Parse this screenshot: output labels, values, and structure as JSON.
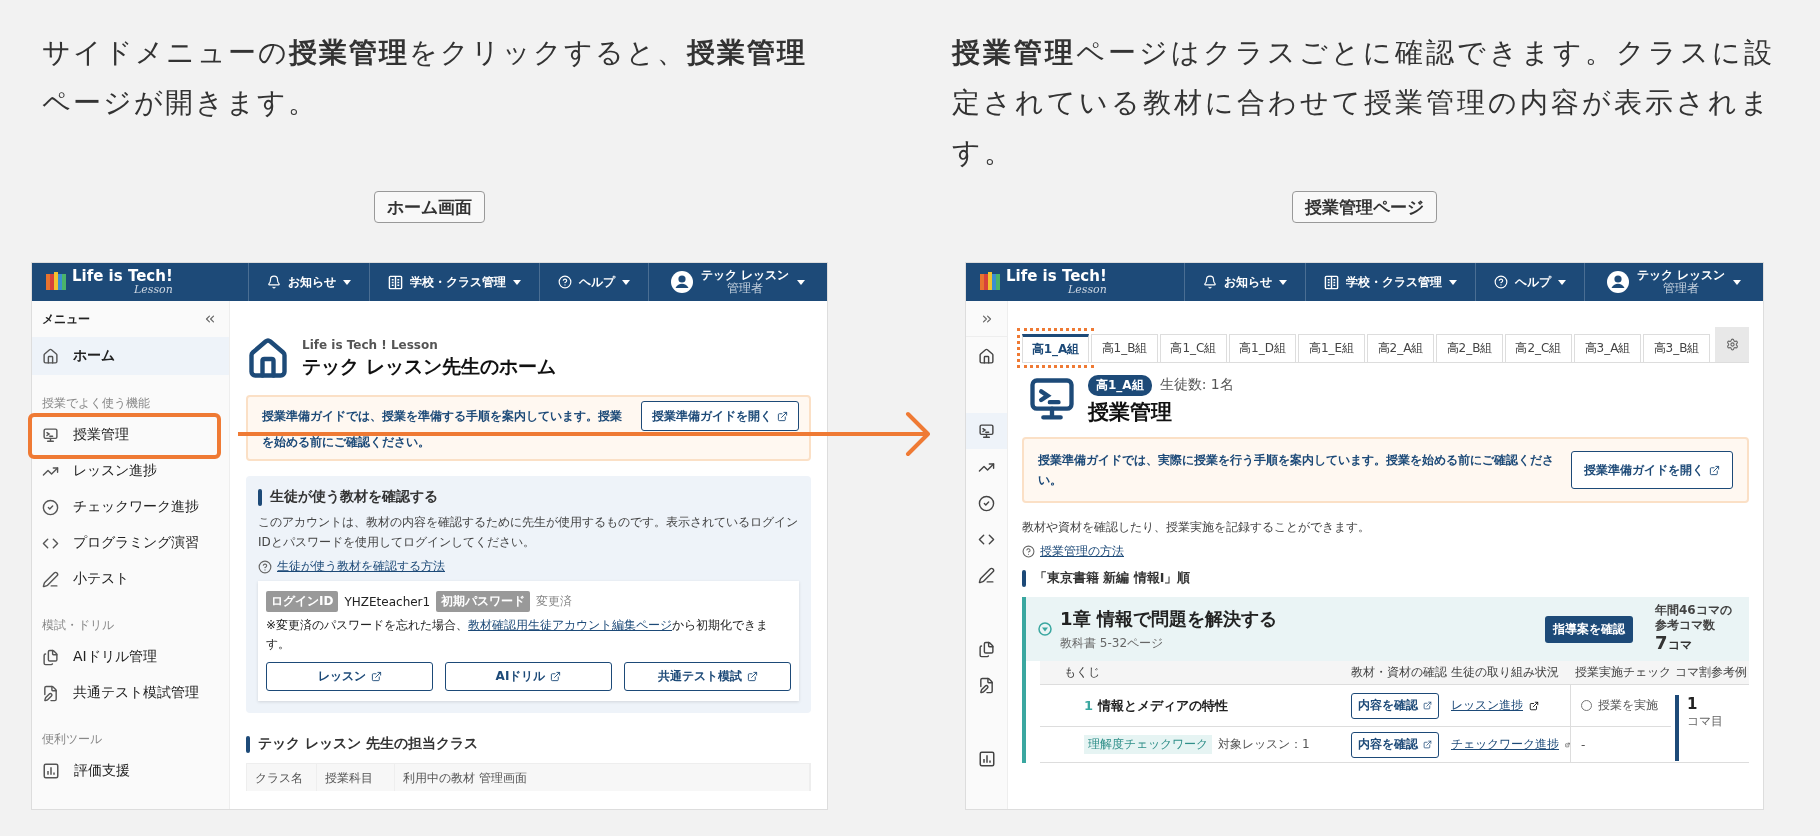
{
  "left": {
    "intro": "サイドメニューの**授業管理**をクリックすると、**授業管理**ページが開きます。",
    "caption": "ホーム画面",
    "screen": {
      "header": {
        "logo": "Life is Tech!",
        "logo_sub": "Lesson",
        "nav": [
          {
            "label": "お知らせ",
            "kind": "bell"
          },
          {
            "label": "学校・クラス管理",
            "kind": "building"
          },
          {
            "label": "ヘルプ",
            "kind": "help"
          }
        ],
        "user": {
          "name": "テック レッスン",
          "role": "管理者"
        }
      },
      "sidebar": {
        "title": "メニュー",
        "sections": [
          {
            "items": [
              {
                "label": "ホーム",
                "kind": "home",
                "selected": true,
                "highlighted": false
              }
            ]
          },
          {
            "heading": "授業でよく使う機能",
            "items": [
              {
                "label": "授業管理",
                "kind": "monitor",
                "selected": false,
                "highlighted": true
              },
              {
                "label": "レッスン進捗",
                "kind": "trend",
                "selected": false,
                "highlighted": false
              },
              {
                "label": "チェックワーク進捗",
                "kind": "check",
                "selected": false,
                "highlighted": false
              },
              {
                "label": "プログラミング演習",
                "kind": "code",
                "selected": false,
                "highlighted": false
              },
              {
                "label": "小テスト",
                "kind": "pen",
                "selected": false,
                "highlighted": false
              }
            ]
          },
          {
            "heading": "模試・ドリル",
            "items": [
              {
                "label": "AIドリル管理",
                "kind": "docs",
                "selected": false,
                "highlighted": false
              },
              {
                "label": "共通テスト模試管理",
                "kind": "docedit",
                "selected": false,
                "highlighted": false
              }
            ]
          },
          {
            "heading": "便利ツール",
            "items": [
              {
                "label": "評価支援",
                "kind": "chart",
                "selected": false,
                "highlighted": false
              }
            ]
          }
        ]
      },
      "brand": "Life is Tech ! Lesson",
      "title": "テック レッスン先生のホーム",
      "notice": {
        "text": "授業準備ガイドでは、授業を準備する手順を案内しています。授業を始める前にご確認ください。",
        "button": "授業準備ガイドを開く"
      },
      "student_panel": {
        "heading": "生徒が使う教材を確認する",
        "body": "このアカウントは、教材の内容を確認するために先生が使用するものです。表示されているログインIDとパスワードを使用してログインしてください。",
        "help_link": "生徒が使う教材を確認する方法",
        "login": {
          "id_label": "ログインID",
          "id": "YHZEteacher1",
          "pw_label": "初期パスワード",
          "pw": "変更済"
        },
        "note_mark": "※",
        "note_before": "変更済のパスワードを忘れた場合、",
        "note_link": "教材確認用生徒アカウント編集ページ",
        "note_after": "から初期化できます。",
        "buttons": [
          "レッスン",
          "AIドリル",
          "共通テスト模試"
        ]
      },
      "classes": {
        "heading": "テック レッスン 先生の担当クラス",
        "columns": [
          "クラス名",
          "授業科目",
          "利用中の教材 管理画面"
        ]
      }
    }
  },
  "right": {
    "intro": "**授業管理**ページはクラスごとに確認できます。クラスに設定されている教材に合わせて授業管理の内容が表示されます。",
    "caption": "授業管理ページ",
    "screen": {
      "header": {
        "logo": "Life is Tech!",
        "logo_sub": "Lesson",
        "nav": [
          {
            "label": "お知らせ",
            "kind": "bell"
          },
          {
            "label": "学校・クラス管理",
            "kind": "building"
          },
          {
            "label": "ヘルプ",
            "kind": "help"
          }
        ],
        "user": {
          "name": "テック レッスン",
          "role": "管理者"
        }
      },
      "rail": {
        "groups": [
          {
            "items": [
              {
                "kind": "home",
                "selected": false
              }
            ]
          },
          {
            "items": [
              {
                "kind": "monitor",
                "selected": true
              },
              {
                "kind": "trend",
                "selected": false
              },
              {
                "kind": "check",
                "selected": false
              },
              {
                "kind": "code",
                "selected": false
              },
              {
                "kind": "pen",
                "selected": false
              }
            ]
          },
          {
            "items": [
              {
                "kind": "docs",
                "selected": false
              },
              {
                "kind": "docedit",
                "selected": false
              }
            ]
          },
          {
            "items": [
              {
                "kind": "chart",
                "selected": false
              }
            ]
          }
        ]
      },
      "tabs": [
        {
          "label": "高1_A組",
          "selected": true,
          "highlighted": true
        },
        {
          "label": "高1_B組",
          "selected": false,
          "highlighted": false
        },
        {
          "label": "高1_C組",
          "selected": false,
          "highlighted": false
        },
        {
          "label": "高1_D組",
          "selected": false,
          "highlighted": false
        },
        {
          "label": "高1_E組",
          "selected": false,
          "highlighted": false
        },
        {
          "label": "高2_A組",
          "selected": false,
          "highlighted": false
        },
        {
          "label": "高2_B組",
          "selected": false,
          "highlighted": false
        },
        {
          "label": "高2_C組",
          "selected": false,
          "highlighted": false
        },
        {
          "label": "高3_A組",
          "selected": false,
          "highlighted": false
        },
        {
          "label": "高3_B組",
          "selected": false,
          "highlighted": false
        }
      ],
      "class_badge": "高1_A組",
      "student_count": "生徒数: 1名",
      "title": "授業管理",
      "notice": {
        "text": "授業準備ガイドでは、実際に授業を行う手順を案内しています。授業を始める前にご確認ください。",
        "button": "授業準備ガイドを開く"
      },
      "description": "教材や資材を確認したり、授業実施を記録することができます。",
      "help_link": "授業管理の方法",
      "order_heading": "「東京書籍 新編 情報I」順",
      "chapter": {
        "title": "1章 情報で問題を解決する",
        "pages": "教科書 5-32ページ",
        "expanded": true,
        "guide_button": "指導案を確認",
        "annual": "年間46コマの参考コマ数",
        "count": "7",
        "unit": "コマ",
        "columns": [
          "もくじ",
          "教材・資材の確認",
          "生徒の取り組み状況",
          "授業実施チェック",
          "コマ割参考例"
        ],
        "lessons": [
          {
            "number": "1",
            "title": "情報とメディアの特性",
            "button": "内容を確認",
            "link": "レッスン進捗",
            "check": {
              "label": "授業を実施",
              "checked": false
            },
            "koma": "1",
            "koma_unit": "コマ目",
            "checkworks": [
              {
                "tag": "理解度チェックワーク",
                "target": "対象レッスン：1",
                "button": "内容を確認",
                "link": "チェックワーク進捗",
                "status": "-"
              }
            ]
          }
        ]
      }
    }
  }
}
